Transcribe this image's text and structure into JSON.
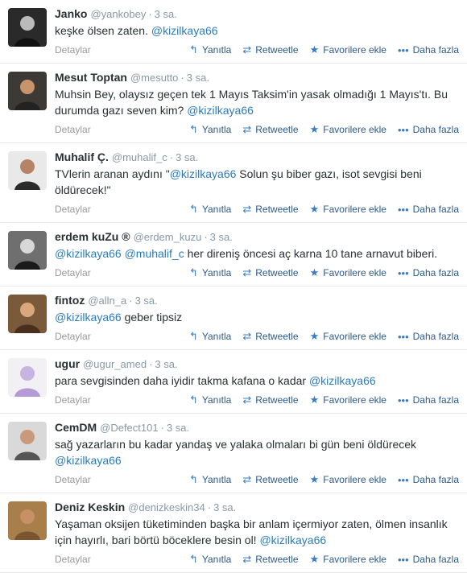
{
  "actions": {
    "details": "Detaylar",
    "reply": "Yanıtla",
    "retweet": "Retweetle",
    "favorite": "Favorilere ekle",
    "more": "Daha fazla"
  },
  "tweets": [
    {
      "name": "Janko",
      "handle": "@yankobey",
      "time": "3 sa.",
      "pre": "keşke ölsen zaten. ",
      "mention": "@kizilkaya66",
      "mid": "",
      "mention2": "",
      "post": ""
    },
    {
      "name": "Mesut Toptan",
      "handle": "@mesutto",
      "time": "3 sa.",
      "pre": "Muhsin Bey, olaysız geçen tek 1 Mayıs Taksim'in yasak olmadığı 1 Mayıs'tı. Bu durumda gazı seven kim? ",
      "mention": "@kizilkaya66",
      "mid": "",
      "mention2": "",
      "post": ""
    },
    {
      "name": "Muhalif Ç.",
      "handle": "@muhalif_c",
      "time": "3 sa.",
      "pre": "TVlerin aranan aydını \"",
      "mention": "@kizilkaya66",
      "mid": " Solun şu biber gazı, isot sevgisi beni öldürecek!\"",
      "mention2": "",
      "post": ""
    },
    {
      "name": "erdem kuZu ®",
      "handle": "@erdem_kuzu",
      "time": "3 sa.",
      "pre": "",
      "mention": "@kizilkaya66",
      "mid": " ",
      "mention2": "@muhalif_c",
      "post": " her direniş öncesi aç karna 10 tane arnavut biberi."
    },
    {
      "name": "fintoz",
      "handle": "@alln_a",
      "time": "3 sa.",
      "pre": "",
      "mention": "@kizilkaya66",
      "mid": " geber tipsiz",
      "mention2": "",
      "post": ""
    },
    {
      "name": "ugur",
      "handle": "@ugur_amed",
      "time": "3 sa.",
      "pre": "para sevgisinden daha iyidir takma kafana o kadar ",
      "mention": "@kizilkaya66",
      "mid": "",
      "mention2": "",
      "post": ""
    },
    {
      "name": "CemDM",
      "handle": "@Defect101",
      "time": "3 sa.",
      "pre": "sağ yazarların bu kadar yandaş ve yalaka olmaları bi gün beni öldürecek ",
      "mention": "@kizilkaya66",
      "mid": "",
      "mention2": "",
      "post": ""
    },
    {
      "name": "Deniz Keskin",
      "handle": "@denizkeskin34",
      "time": "3 sa.",
      "pre": "Yaşaman oksijen tüketiminden başka bir anlam içermiyor zaten, ölmen insanlık için hayırlı, bari börtü böceklere besin ol! ",
      "mention": "@kizilkaya66",
      "mid": "",
      "mention2": "",
      "post": ""
    }
  ]
}
